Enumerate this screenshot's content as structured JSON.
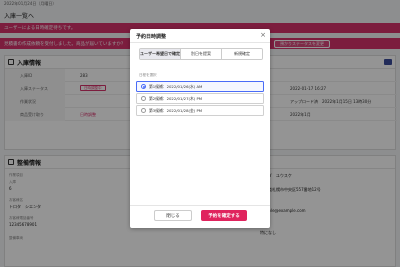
{
  "page": {
    "top_date": "2022年01月24日（月曜日）",
    "title": "入庫一覧へ",
    "alert1": "ユーザーによる日時確定待ちです。",
    "alert2": "見積書の作成依頼を受付しました。商品が届いていますか？",
    "status_button": "預かりステータスを変更"
  },
  "section1": {
    "title": "入庫情報",
    "rows": [
      {
        "label": "入庫ID",
        "value": "283",
        "rlabel": "",
        "rvalue": ""
      },
      {
        "label": "入庫ステータス",
        "value": "日時調整中",
        "rlabel": "入庫予定日",
        "rvalue": "2022-01-17 16:27"
      },
      {
        "label": "作業状況",
        "value": "",
        "rlabel": "",
        "rvalue": "アップロード済　2022年1月15日 13時30分"
      },
      {
        "label": "商品受け取り",
        "value": "日時調整",
        "rlabel": "",
        "rvalue": "2022年1月"
      }
    ]
  },
  "section2": {
    "title": "整備情報",
    "fields": [
      {
        "label": "作業項目",
        "value": ""
      },
      {
        "label": "入庫",
        "value": "6"
      },
      {
        "label": "お客様名",
        "value": "トロタ　シエンタ"
      },
      {
        "label": "お客様電話番号",
        "value": "12345678901"
      },
      {
        "label": "整備車両",
        "value": ""
      }
    ],
    "right": [
      "ライダ　ユウスケ",
      "北海道札幌市中央区557番地12号",
      "sample@example.com",
      "特になし"
    ]
  },
  "modal": {
    "title": "予約日時調整",
    "close_icon": "×",
    "tabs": [
      "ユーザー希望日で確定",
      "別日を提案",
      "新規確定"
    ],
    "list_label": "日程を選択",
    "options": [
      {
        "label": "第1候補：2022/01/26(水) AM",
        "selected": true
      },
      {
        "label": "第2候補：2022/01/27(木) PM",
        "selected": false
      },
      {
        "label": "第3候補：2022/01/28(金) PM",
        "selected": false
      }
    ],
    "close_button": "閉じる",
    "confirm_button": "予約を確定する"
  },
  "colors": {
    "accent": "#e0245e",
    "selected_border": "#4a6cf7"
  }
}
